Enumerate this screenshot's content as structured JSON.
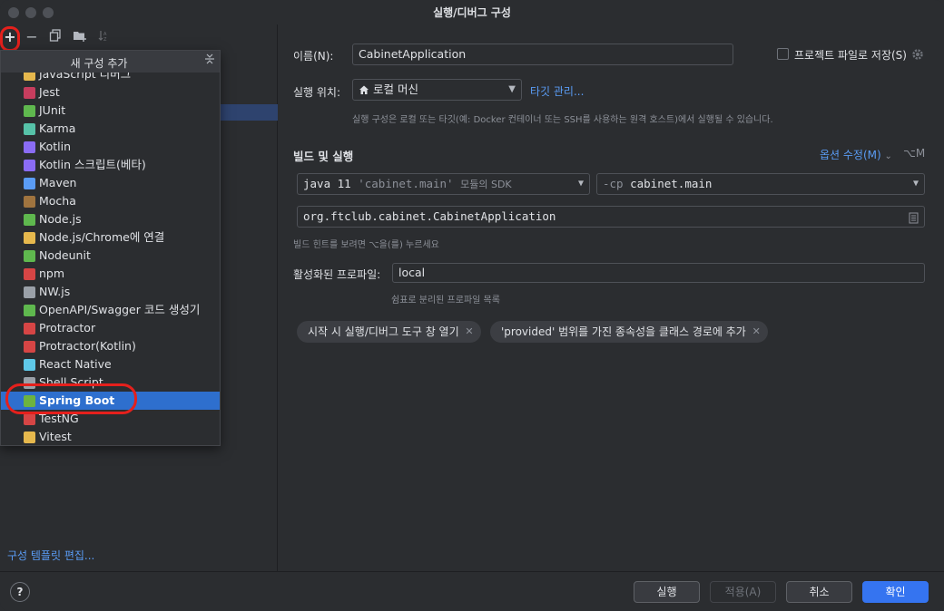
{
  "window": {
    "title": "실행/디버그 구성"
  },
  "toolbar": {
    "add_icon": "+",
    "remove_icon": "−",
    "copy_icon": "copy-icon",
    "folder_icon": "folder-plus-icon",
    "sort_icon": "sort-icon"
  },
  "popup": {
    "title": "새 구성 추가",
    "collapse_icon": "collapse-all-icon",
    "items": [
      {
        "label": "JavaScript 디버그",
        "icon": "javascript-debug-icon",
        "color": "#e6b84d"
      },
      {
        "label": "Jest",
        "icon": "jest-icon",
        "color": "#c63d5e"
      },
      {
        "label": "JUnit",
        "icon": "junit-icon",
        "color": "#5fb84e"
      },
      {
        "label": "Karma",
        "icon": "karma-icon",
        "color": "#56c2a8"
      },
      {
        "label": "Kotlin",
        "icon": "kotlin-icon",
        "color": "#8a6cf5"
      },
      {
        "label": "Kotlin 스크립트(베타)",
        "icon": "kotlin-script-icon",
        "color": "#8a6cf5"
      },
      {
        "label": "Maven",
        "icon": "maven-icon",
        "color": "#5a9cf5"
      },
      {
        "label": "Mocha",
        "icon": "mocha-icon",
        "color": "#a0743f"
      },
      {
        "label": "Node.js",
        "icon": "nodejs-icon",
        "color": "#5fb84e"
      },
      {
        "label": "Node.js/Chrome에 연결",
        "icon": "nodejs-chrome-icon",
        "color": "#e6b84d"
      },
      {
        "label": "Nodeunit",
        "icon": "nodeunit-icon",
        "color": "#5fb84e"
      },
      {
        "label": "npm",
        "icon": "npm-icon",
        "color": "#d64545"
      },
      {
        "label": "NW.js",
        "icon": "nwjs-icon",
        "color": "#9aa0a8"
      },
      {
        "label": "OpenAPI/Swagger 코드 생성기",
        "icon": "openapi-icon",
        "color": "#5fb84e"
      },
      {
        "label": "Protractor",
        "icon": "protractor-icon",
        "color": "#d64545"
      },
      {
        "label": "Protractor(Kotlin)",
        "icon": "protractor-kotlin-icon",
        "color": "#d64545"
      },
      {
        "label": "React Native",
        "icon": "react-native-icon",
        "color": "#5fc8e8"
      },
      {
        "label": "Shell Script",
        "icon": "shell-script-icon",
        "color": "#9aa0a8"
      },
      {
        "label": "Spring Boot",
        "icon": "spring-boot-icon",
        "color": "#6db33f",
        "selected": true
      },
      {
        "label": "TestNG",
        "icon": "testng-icon",
        "color": "#d64545"
      },
      {
        "label": "Vitest",
        "icon": "vitest-icon",
        "color": "#e6b84d"
      }
    ]
  },
  "left": {
    "template_link": "구성 템플릿 편집..."
  },
  "form": {
    "name_label": "이름(N):",
    "name_value": "CabinetApplication",
    "store_label": "프로젝트 파일로 저장(S)",
    "run_on_label": "실행 위치:",
    "run_on_value": "로컬 머신",
    "manage_targets": "타깃 관리...",
    "run_on_hint": "실행 구성은 로컬 또는 타깃(예: Docker 컨테이너 또는 SSH를 사용하는 원격 호스트)에서 실행될 수 있습니다.",
    "build_section": "빌드 및 실행",
    "modify_options": "옵션 수정(M)",
    "modify_shortcut": "⌥M",
    "sdk_prefix": "java 11",
    "sdk_module": "'cabinet.main'",
    "sdk_suffix": "모듈의 SDK",
    "cp_flag": "-cp",
    "cp_value": "cabinet.main",
    "main_class": "org.ftclub.cabinet.CabinetApplication",
    "build_hint": "빌드 힌트를 보려면 ⌥을(를) 누르세요",
    "profiles_label": "활성화된 프로파일:",
    "profiles_value": "local",
    "profiles_hint": "쉼표로 분리된 프로파일 목록",
    "chips": [
      "시작 시 실행/디버그 도구 창 열기",
      "'provided' 범위를 가진 종속성을 클래스 경로에 추가"
    ]
  },
  "buttons": {
    "help": "?",
    "run": "실행",
    "apply": "적용(A)",
    "cancel": "취소",
    "ok": "확인"
  }
}
